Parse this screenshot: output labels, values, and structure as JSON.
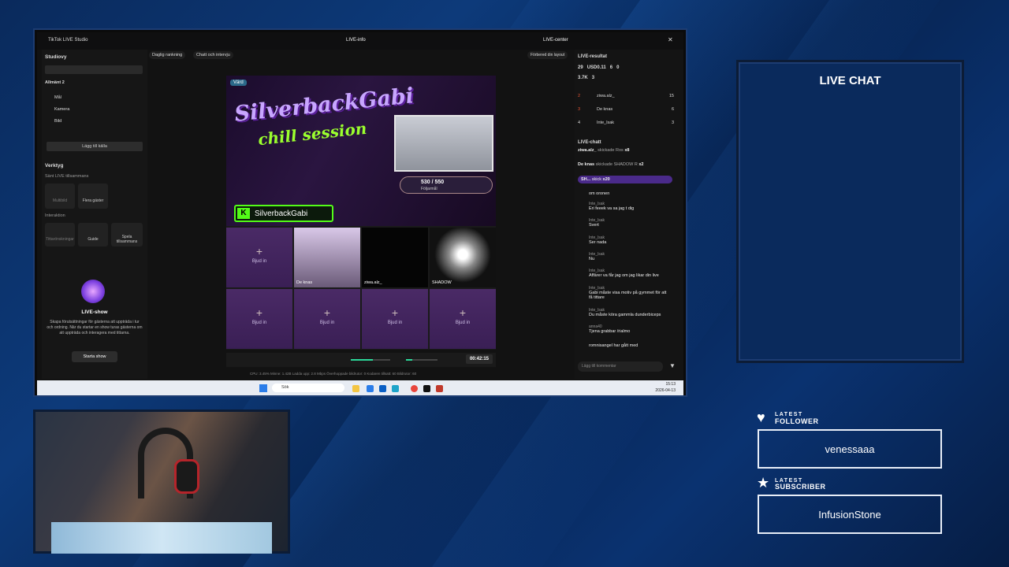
{
  "overlay": {
    "live_chat_title": "LIVE CHAT",
    "latest_follower_top": "LATEST",
    "latest_follower_bottom": "FOLLOWER",
    "latest_follower_name": "venessaaa",
    "latest_subscriber_top": "LATEST",
    "latest_subscriber_bottom": "SUBSCRIBER",
    "latest_subscriber_name": "InfusionStone"
  },
  "app": {
    "title": "TikTok LIVE Studio",
    "center_title": "LIVE-info",
    "live_center": "LIVE-center"
  },
  "left_panel": {
    "studio_label": "Studiovy",
    "scene_label": "Allmänt 2",
    "sources": [
      "Mål",
      "Kamera",
      "Bild"
    ],
    "add_source": "Lägg till källa",
    "tools_heading": "Verktyg",
    "live_together": "Sänt LIVE tillsammans",
    "tool_multiguest": "Multibild",
    "tool_more_guests": "Flera gäster",
    "interaction": "Interaktion",
    "tool_viewer_requests": "Tittarönskningar",
    "tool_guide": "Guide",
    "tool_play_together": "Spela tillsammans",
    "live_show_title": "LIVE-show",
    "live_show_desc": "Skapa förutsättningar för gästerna att uppträda i tur och ordning. När du startar en show turas gästerna om att uppträda och interagera med tittarna.",
    "start_show": "Starta show"
  },
  "center": {
    "chip_daily": "Daglig rankning",
    "chip_chat": "Chatt och intervju",
    "chip_layout": "Förbered din layout",
    "host_badge": "Värd",
    "hero_title_line1": "SilverbackGabi",
    "hero_title_line2": "chill session",
    "kick_name": "SilverbackGabi",
    "followers": "530 / 550",
    "followers_label": "Följarmål",
    "guests": [
      {
        "name": "",
        "label": "Bjud in"
      },
      {
        "name": "De knas",
        "label": ""
      },
      {
        "name": "ziwa.alz_",
        "label": ""
      },
      {
        "name": "SHADOW",
        "label": ""
      },
      {
        "name": "",
        "label": "Bjud in"
      },
      {
        "name": "",
        "label": "Bjud in"
      },
      {
        "name": "",
        "label": "Bjud in"
      },
      {
        "name": "",
        "label": "Bjud in"
      }
    ],
    "timer": "00:42:15",
    "status": "CPU: 3.45%   Minne: 1.42B   Ladda upp: 2.8 Mbps   Överhoppade bildrutor: 0   Kodaren tillsatt: 60   Bildrutor: 60"
  },
  "right_panel": {
    "results_title": "LIVE-resultat",
    "stats": [
      "29",
      "USD0.11",
      "6",
      "0",
      "3.7K",
      "3"
    ],
    "ranking": [
      {
        "rank": "2",
        "name": "ziwa.alz_",
        "score": "15"
      },
      {
        "rank": "3",
        "name": "De knas",
        "score": "6"
      },
      {
        "rank": "4",
        "name": "Inte_lsak",
        "score": "3"
      }
    ],
    "chat_title": "LIVE-chatt",
    "gifts": [
      {
        "user": "ziwa.alz_",
        "text": "skickade Ros",
        "count": "x8"
      },
      {
        "user": "De knas",
        "text": "skickade SHADOW R",
        "count": "x2"
      },
      {
        "user": "SH...",
        "text": "skick",
        "count": "x20"
      }
    ],
    "messages": [
      {
        "user": "",
        "text": "om oronen"
      },
      {
        "user": "Inte_lsak",
        "text": "Eri feeek va sa jag t dig"
      },
      {
        "user": "Inte_lsak",
        "text": "Svert"
      },
      {
        "user": "Inte_lsak",
        "text": "Ser nada"
      },
      {
        "user": "Inte_lsak",
        "text": "Nu"
      },
      {
        "user": "Inte_lsak",
        "text": "Affärer va får jag om jag likar din live"
      },
      {
        "user": "Inte_lsak",
        "text": "Gabi måste visa motiv på gymmet för att få tittare"
      },
      {
        "user": "Inte_lsak",
        "text": "Du måste köra gammla dunderbiceps"
      },
      {
        "user": "anna40",
        "text": "Tjena grabbar /rialmo"
      },
      {
        "user": "",
        "text": "romnisangel har gått med"
      }
    ],
    "comment_placeholder": "Lägg till kommentar"
  },
  "taskbar": {
    "search": "Sök",
    "time": "15:13",
    "date": "2026-04-13"
  },
  "colors": {
    "accent_purple": "#7b3fe0",
    "green": "#53fc18",
    "bg_blue": "#0a2a5c"
  }
}
